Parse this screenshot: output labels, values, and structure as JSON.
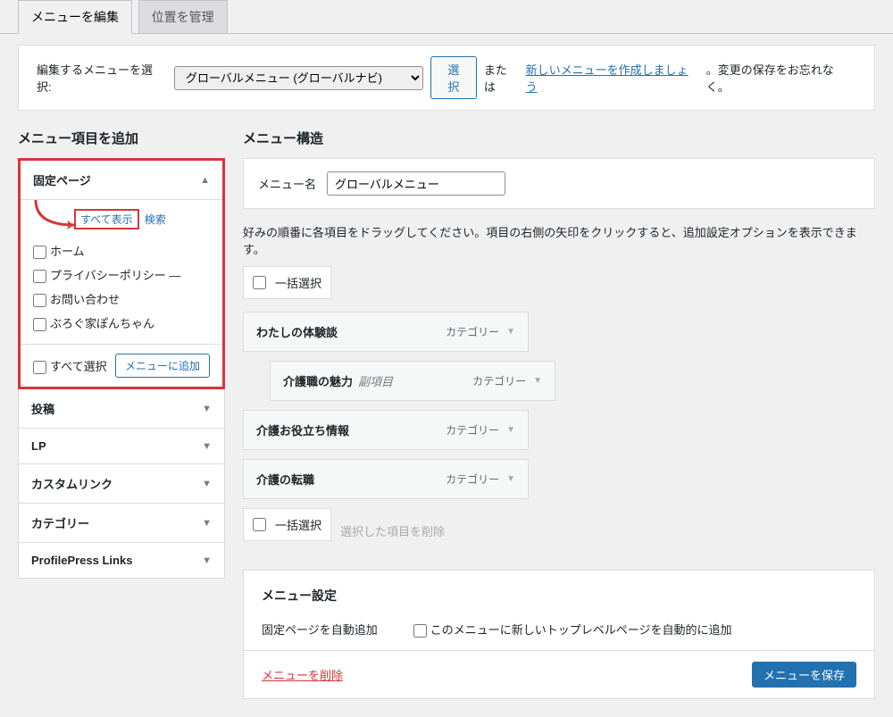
{
  "tabs": {
    "edit": "メニューを編集",
    "locations": "位置を管理"
  },
  "select_row": {
    "label": "編集するメニューを選択:",
    "option": "グローバルメニュー (グローバルナビ)",
    "button": "選択",
    "or": "または",
    "create_link": "新しいメニューを作成しましょう",
    "tail": "。変更の保存をお忘れなく。"
  },
  "left": {
    "title": "メニュー項目を追加",
    "fixed_page": "固定ページ",
    "subtabs": {
      "all": "すべて表示",
      "search": "検索"
    },
    "checklist": [
      "ホーム",
      "プライバシーポリシー —",
      "お問い合わせ",
      "ぶろぐ家ぽんちゃん"
    ],
    "select_all": "すべて選択",
    "add_to_menu": "メニューに追加",
    "sections": [
      "投稿",
      "LP",
      "カスタムリンク",
      "カテゴリー",
      "ProfilePress Links"
    ]
  },
  "right": {
    "title": "メニュー構造",
    "menu_name_label": "メニュー名",
    "menu_name_value": "グローバルメニュー",
    "help": "好みの順番に各項目をドラッグしてください。項目の右側の矢印をクリックすると、追加設定オプションを表示できます。",
    "bulk_select": "一括選択",
    "items": [
      {
        "title": "わたしの体験談",
        "type": "カテゴリー",
        "indent": false
      },
      {
        "title": "介護職の魅力",
        "sub": "副項目",
        "type": "カテゴリー",
        "indent": true
      },
      {
        "title": "介護お役立ち情報",
        "type": "カテゴリー",
        "indent": false
      },
      {
        "title": "介護の転職",
        "type": "カテゴリー",
        "indent": false
      }
    ],
    "delete_selected": "選択した項目を削除",
    "settings_title": "メニュー設定",
    "auto_add_label": "固定ページを自動追加",
    "auto_add_check": "このメニューに新しいトップレベルページを自動的に追加",
    "delete_menu": "メニューを削除",
    "save_menu": "メニューを保存"
  }
}
